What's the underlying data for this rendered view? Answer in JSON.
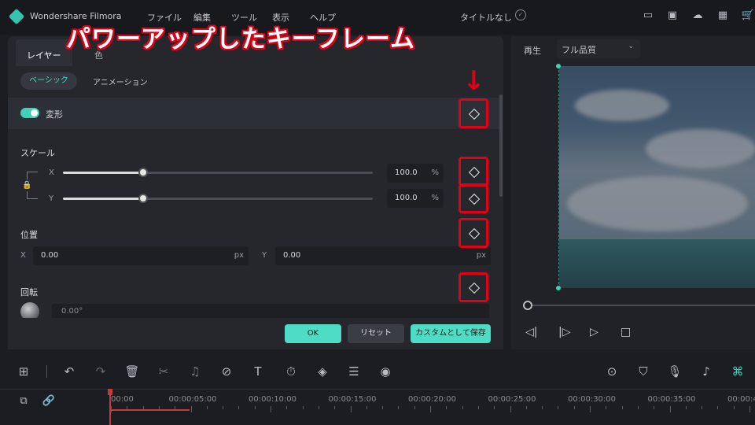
{
  "app": {
    "name": "Wondershare Filmora",
    "menu": [
      "ファイル",
      "編集",
      "ツール",
      "表示",
      "ヘルプ"
    ],
    "document_title": "タイトルなし",
    "top_icons": [
      "monitor-icon",
      "save-icon",
      "cloud-upload-icon",
      "grid-icon",
      "cart-icon"
    ]
  },
  "annotation": {
    "headline": "パワーアップしたキーフレーム",
    "arrow": "↓",
    "highlight_color": "#e00018"
  },
  "panel": {
    "tabs": [
      "レイヤー",
      "色"
    ],
    "subtabs": [
      "ベーシック",
      "アニメーション"
    ],
    "transform": {
      "label": "変形",
      "enabled": true
    },
    "scale": {
      "label": "スケール",
      "x": {
        "axis": "X",
        "value": "100.0",
        "unit": "%",
        "level": 0.26
      },
      "y": {
        "axis": "Y",
        "value": "100.0",
        "unit": "%",
        "level": 0.26
      }
    },
    "position": {
      "label": "位置",
      "x": {
        "axis": "X",
        "value": "0.00",
        "unit": "px"
      },
      "y": {
        "axis": "Y",
        "value": "0.00",
        "unit": "px"
      }
    },
    "rotation": {
      "label": "回転",
      "value": "0.00°"
    },
    "buttons": {
      "ok": "OK",
      "reset": "リセット",
      "save_custom": "カスタムとして保存"
    }
  },
  "preview": {
    "label": "再生",
    "quality": "フル品質",
    "accent": "#3fd0b6"
  },
  "timeline": {
    "ticks": [
      "00:00",
      "00:00:05:00",
      "00:00:10:00",
      "00:00:15:00",
      "00:00:20:00",
      "00:00:25:00",
      "00:00:30:00",
      "00:00:35:00",
      "00:00:4"
    ]
  },
  "colors": {
    "accent": "#4fdcc4",
    "panel_bg": "#25272c",
    "app_bg": "#1b1d22"
  }
}
